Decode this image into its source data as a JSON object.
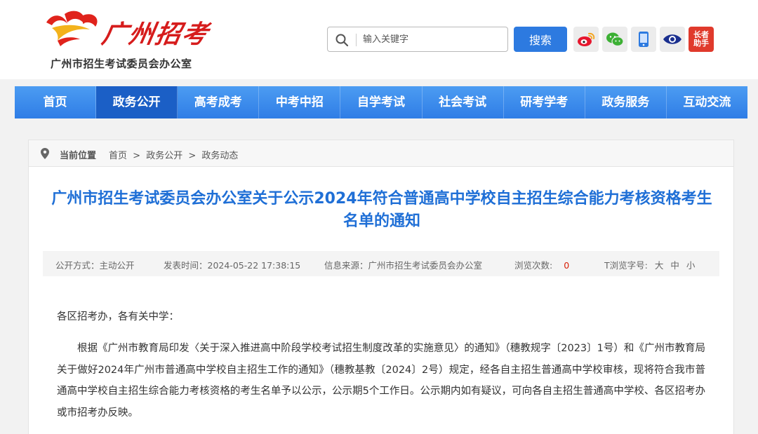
{
  "header": {
    "logo_text": "广州招考",
    "org_name": "广州市招生考试委员会办公室",
    "search": {
      "placeholder": "输入关键字",
      "button_label": "搜索"
    },
    "share_icons": [
      "weibo-icon",
      "wechat-icon",
      "mobile-icon",
      "eye-icon",
      "elder-assist-icon"
    ],
    "elder_label_line1": "长者",
    "elder_label_line2": "助手"
  },
  "nav": {
    "items": [
      {
        "label": "首页",
        "active": false
      },
      {
        "label": "政务公开",
        "active": true
      },
      {
        "label": "高考成考",
        "active": false
      },
      {
        "label": "中考中招",
        "active": false
      },
      {
        "label": "自学考试",
        "active": false
      },
      {
        "label": "社会考试",
        "active": false
      },
      {
        "label": "研考学考",
        "active": false
      },
      {
        "label": "政务服务",
        "active": false
      },
      {
        "label": "互动交流",
        "active": false
      }
    ]
  },
  "breadcrumb": {
    "label": "当前位置",
    "items": [
      "首页",
      ">",
      "政务公开",
      ">",
      "政务动态"
    ]
  },
  "article": {
    "title": "广州市招生考试委员会办公室关于公示2024年符合普通高中学校自主招生综合能力考核资格考生名单的通知",
    "meta": {
      "disclosure": "公开方式：主动公开",
      "published": "发表时间：2024-05-22 17:38:15",
      "source": "信息来源：广州市招生考试委员会办公室",
      "views_label": "浏览次数:",
      "views_count": "0",
      "font_label": "T浏览字号:",
      "font_large": "大",
      "font_medium": "中",
      "font_small": "小"
    },
    "greeting": "各区招考办，各有关中学：",
    "paragraph": "根据《广州市教育局印发〈关于深入推进高中阶段学校考试招生制度改革的实施意见〉的通知》（穗教规字〔2023〕1号）和《广州市教育局关于做好2024年广州市普通高中学校自主招生工作的通知》（穗教基教〔2024〕2号）规定，经各自主招生普通高中学校审核，现将符合我市普通高中学校自主招生综合能力考核资格的考生名单予以公示，公示期5个工作日。公示期内如有疑议，可向各自主招生普通高中学校、各区招考办或市招考办反映。"
  },
  "colors": {
    "accent": "#2d7ae0",
    "nav_active": "#1b5fc6",
    "title": "#1f6fd6",
    "logo_red": "#d61c1c"
  }
}
